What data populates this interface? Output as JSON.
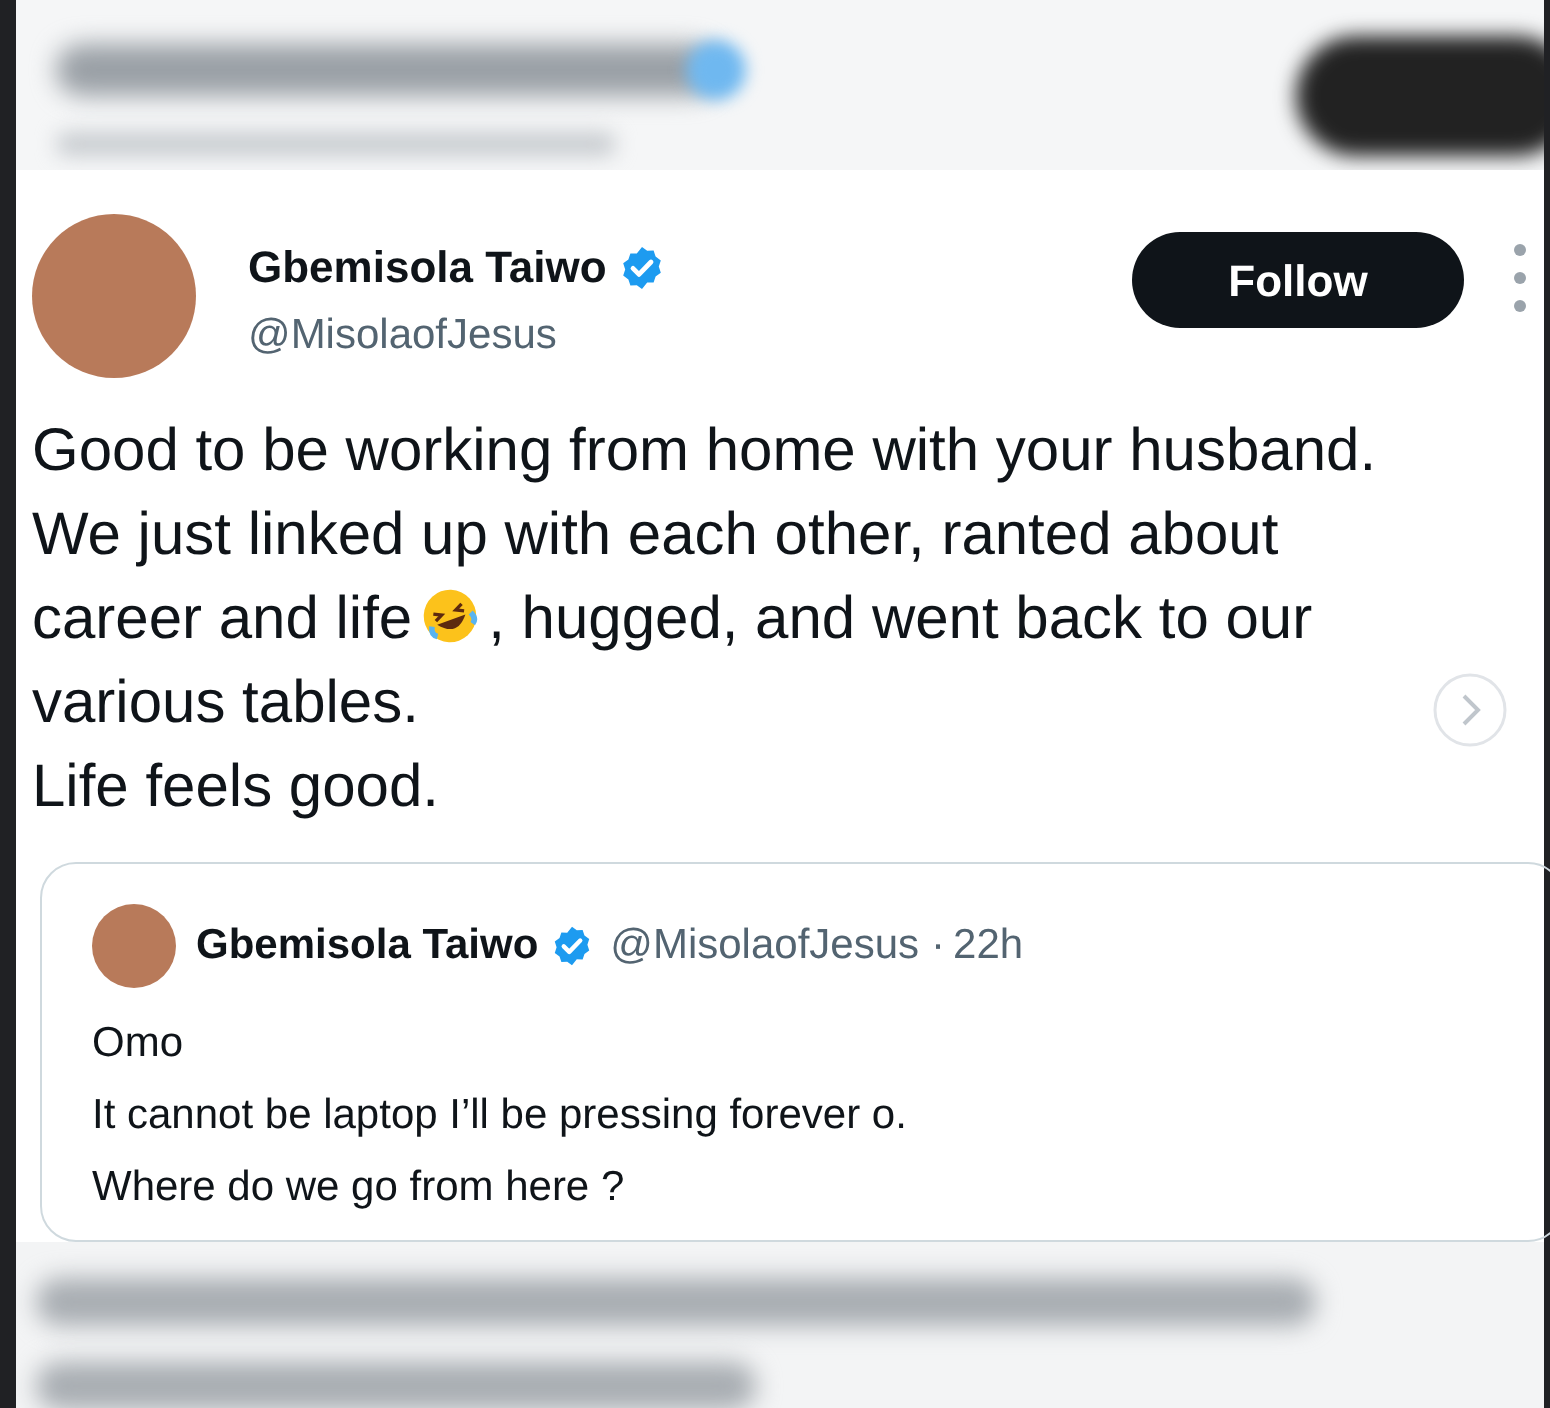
{
  "author": {
    "name": "Gbemisola Taiwo",
    "handle": "@MisolaofJesus",
    "verified": true
  },
  "follow_button": "Follow",
  "tweet_lines": [
    {
      "segments": [
        "Good to be working from home with your husband."
      ]
    },
    {
      "segments": [
        "We just linked up with each other, ranted about"
      ]
    },
    {
      "segments": [
        "career and life",
        ", hugged, and went back to our"
      ]
    },
    {
      "segments": [
        "various tables."
      ]
    },
    {
      "segments": [
        "Life feels good."
      ]
    }
  ],
  "quoted": {
    "name": "Gbemisola Taiwo",
    "handle": "@MisolaofJesus",
    "verified": true,
    "separator": "·",
    "time": "22h",
    "lines": [
      "Omo",
      "It cannot be laptop I’ll be pressing forever o.",
      "Where do we go from here ?"
    ]
  }
}
